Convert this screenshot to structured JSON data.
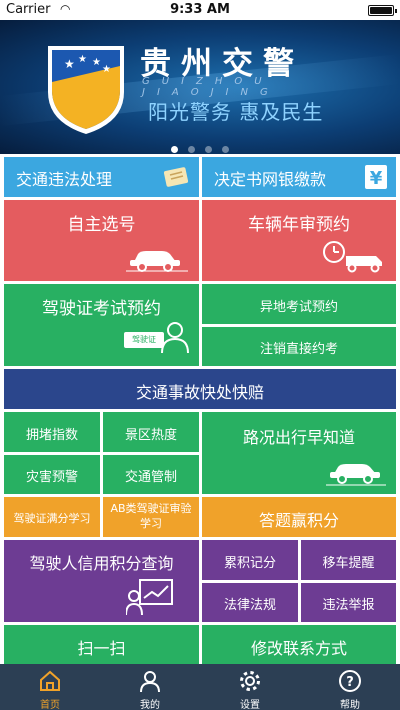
{
  "status_bar": {
    "carrier": "Carrier",
    "time": "9:33 AM"
  },
  "banner": {
    "title": "贵州交警",
    "pinyin": "GUIZHOU JIAOJING",
    "slogan": "阳光警务  惠及民生",
    "page_count": 4,
    "active_page": 1
  },
  "tiles": {
    "traffic_violation": "交通违法处理",
    "decision_payment": "决定书网银缴款",
    "self_select_plate": "自主选号",
    "vehicle_inspection": "车辆年审预约",
    "license_exam": "驾驶证考试预约",
    "remote_exam": "异地考试预约",
    "cancel_direct_exam": "注销直接约考",
    "accident_quick": "交通事故快处快赔",
    "congestion_index": "拥堵指数",
    "scenic_heat": "景区热度",
    "road_conditions": "路况出行早知道",
    "disaster_warning": "灾害预警",
    "traffic_control": "交通管制",
    "full_points_study": "驾驶证满分学习",
    "ab_review_study": "AB类驾驶证审验学习",
    "quiz_points": "答题赢积分",
    "credit_query": "驾驶人信用积分查询",
    "cumulative_points": "累积记分",
    "move_car": "移车提醒",
    "laws": "法律法规",
    "report_violation": "违法举报",
    "scan": "扫一扫",
    "edit_contact": "修改联系方式",
    "license_badge": "驾驶证"
  },
  "tabbar": {
    "items": [
      {
        "label": "首页",
        "icon": "home-icon"
      },
      {
        "label": "我的",
        "icon": "user-icon"
      },
      {
        "label": "设置",
        "icon": "gear-icon"
      },
      {
        "label": "帮助",
        "icon": "help-icon"
      }
    ],
    "active": 0
  },
  "colors": {
    "blue": "#3ba7e0",
    "red": "#e45c5f",
    "green": "#28b062",
    "navy": "#2b468c",
    "orange": "#f0a22a",
    "purple": "#6d3c93",
    "tabbar": "#2c3f54"
  }
}
